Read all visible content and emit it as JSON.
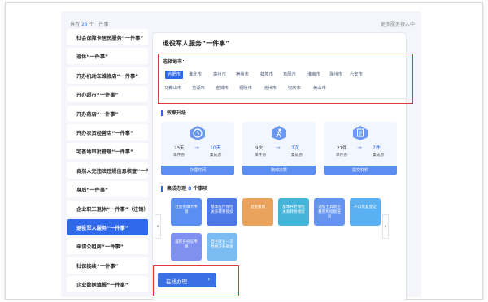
{
  "topbar": {
    "count_prefix": "共有",
    "count": "28",
    "count_suffix": "个一件事",
    "more": "更多服务接入中"
  },
  "sidebar": {
    "items": [
      {
        "label": "社会保障卡居民服务“一件事”"
      },
      {
        "label": "退休“一件事”"
      },
      {
        "label": "开办机动车维修店“一件事”"
      },
      {
        "label": "开办超市“一件事”"
      },
      {
        "label": "开办药店“一件事”"
      },
      {
        "label": "开办农资经营店“一件事”"
      },
      {
        "label": "宅基地审批管理“一件事”"
      },
      {
        "label": "自然人无违法违规信息核查“一件事”"
      },
      {
        "label": "身后“一件事”"
      },
      {
        "label": "企业职工退休“一件事”（注销）"
      },
      {
        "label": "退役军人服务“一件事”"
      },
      {
        "label": "申请公租房“一件事”"
      },
      {
        "label": "社保接续“一件事”"
      },
      {
        "label": "企业数据填报“一件事”"
      }
    ],
    "active_index": 10
  },
  "main": {
    "title": "退役军人服务“一件事”",
    "region_label": "选择地市：",
    "cities_row1": [
      "合肥市",
      "淮北市",
      "亳州市",
      "宿州市",
      "蚌埠市",
      "阜阳市",
      "淮南市",
      "滁州市",
      "六安市"
    ],
    "cities_row2": [
      "马鞍山市",
      "芜湖市",
      "宣城市",
      "铜陵市",
      "池州市",
      "安庆市",
      "黄山市"
    ],
    "efficiency_title": "效率升级",
    "cards": [
      {
        "from_num": "23天",
        "from_label": "单件办",
        "to_num": "10天",
        "to_label": "集成办",
        "footer": "办理时间"
      },
      {
        "from_num": "9次",
        "from_label": "单件办",
        "to_num": "3次",
        "to_label": "集成办",
        "footer": "跑动次数"
      },
      {
        "from_num": "21件",
        "from_label": "单件办",
        "to_num": "7件",
        "to_label": "集成办",
        "footer": "提交材料"
      }
    ],
    "items_title_prefix": "集成办理",
    "items_count": "8",
    "items_title_suffix": "个事项",
    "tiles": [
      {
        "label": "社会保障卡申领",
        "color": "#5a8ef0"
      },
      {
        "label": "基本医疗保险关系转移接续",
        "color": "#4c79e6"
      },
      {
        "label": "退役报到",
        "color": "#e9a35c"
      },
      {
        "label": "基本养老保险关系转移接续",
        "color": "#45b4d9"
      },
      {
        "label": "退役士兵职业教育和技能培训",
        "color": "#6494f0"
      },
      {
        "label": "户口恢复登记",
        "color": "#5ab0f0"
      },
      {
        "label": "居民身份证申领",
        "color": "#7f90f0"
      },
      {
        "label": "自主就业一次性经济补助金",
        "color": "#7abbf2"
      }
    ],
    "online_label": "在线办理"
  }
}
